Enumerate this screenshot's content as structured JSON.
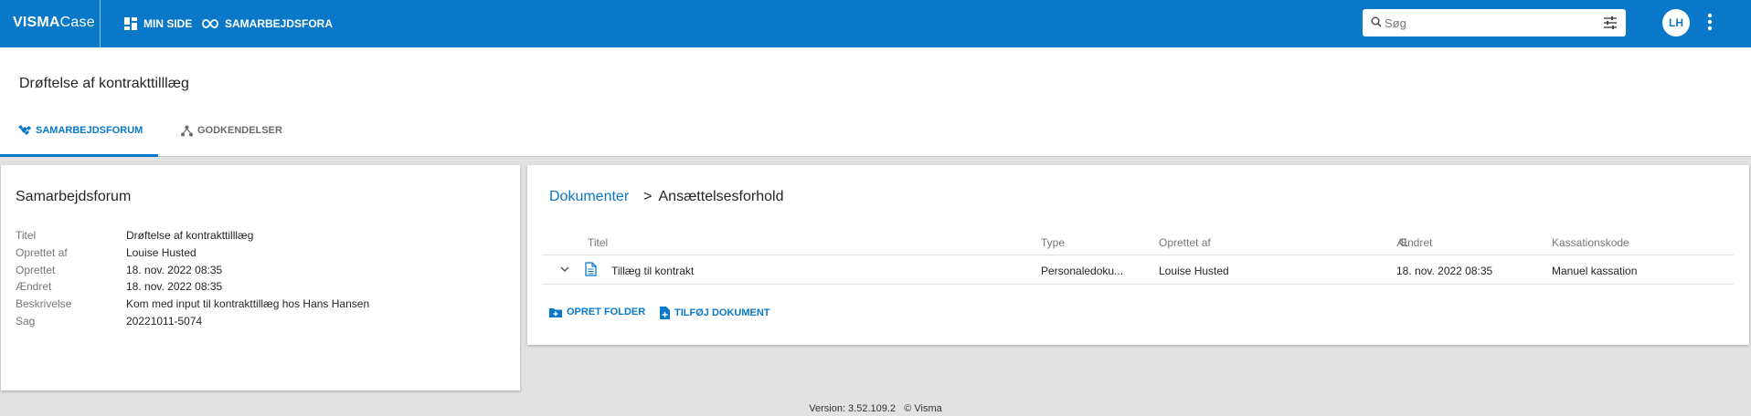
{
  "topbar": {
    "brand": "VISMA",
    "product": "Case",
    "nav": [
      {
        "label": "MIN SIDE",
        "icon": "dashboard-icon"
      },
      {
        "label": "SAMARBEJDSFORA",
        "icon": "infinity-icon"
      }
    ],
    "search": {
      "placeholder": "Søg",
      "value": ""
    },
    "user_initials": "LH"
  },
  "header": {
    "title": "Drøftelse af kontrakttilllæg",
    "tabs": [
      {
        "label": "SAMARBEJDSFORUM",
        "icon": "handshake-icon",
        "active": true
      },
      {
        "label": "GODKENDELSER",
        "icon": "hierarchy-icon",
        "active": false
      }
    ]
  },
  "details": {
    "heading": "Samarbejdsforum",
    "rows": [
      {
        "key": "Titel",
        "value": "Drøftelse af kontrakttilllæg"
      },
      {
        "key": "Oprettet af",
        "value": "Louise Husted"
      },
      {
        "key": "Oprettet",
        "value": "18. nov. 2022 08:35"
      },
      {
        "key": "Ændret",
        "value": "18. nov. 2022 08:35"
      },
      {
        "key": "Beskrivelse",
        "value": "Kom med input til kontrakttillæg hos Hans Hansen"
      },
      {
        "key": "Sag",
        "value": "20221011-5074"
      }
    ]
  },
  "documents": {
    "breadcrumb": {
      "root": "Dokumenter",
      "separator": ">",
      "current": "Ansættelsesforhold"
    },
    "columns": [
      "Titel",
      "Type",
      "Oprettet af",
      "Ændret",
      "Kassationskode"
    ],
    "rows": [
      {
        "title": "Tillæg til kontrakt",
        "type": "Personaledoku...",
        "created_by": "Louise Husted",
        "modified": "18. nov. 2022 08:35",
        "disposal": "Manuel kassation"
      }
    ],
    "actions": {
      "create_folder": "OPRET FOLDER",
      "add_document": "TILFØJ DOKUMENT"
    }
  },
  "footer": {
    "version": "Version: 3.52.109.2",
    "copyright": "© Visma"
  },
  "colors": {
    "primary": "#0a78c8",
    "background": "#e2e2e2"
  }
}
